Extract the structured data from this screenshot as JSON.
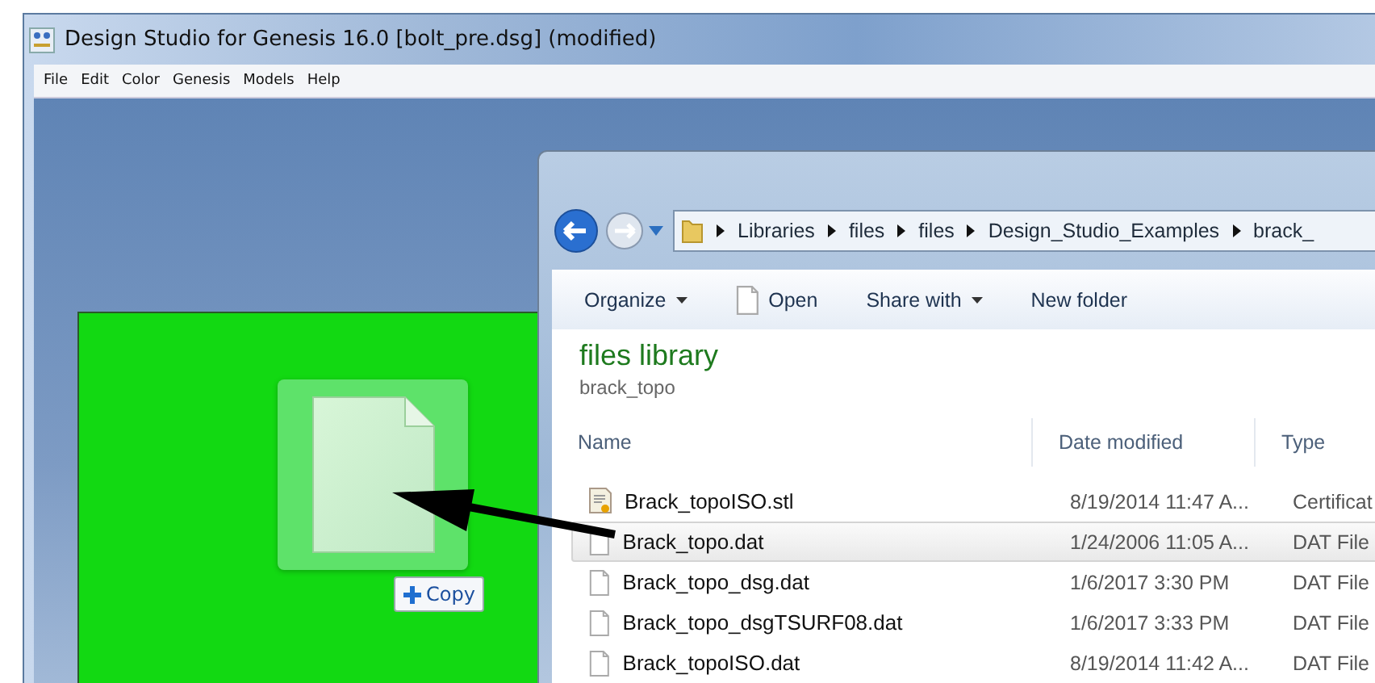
{
  "window": {
    "title": "Design Studio for Genesis 16.0 [bolt_pre.dsg] (modified)"
  },
  "menu": [
    "File",
    "Edit",
    "Color",
    "Genesis",
    "Models",
    "Help"
  ],
  "drag": {
    "badge": "Copy"
  },
  "explorer": {
    "breadcrumb": [
      "Libraries",
      "files",
      "files",
      "Design_Studio_Examples",
      "brack_"
    ],
    "toolbar": [
      {
        "label": "Organize",
        "kind": "menu"
      },
      {
        "label": "Open",
        "kind": "file"
      },
      {
        "label": "Share with",
        "kind": "menu"
      },
      {
        "label": "New folder",
        "kind": "plain"
      }
    ],
    "library_title": "files library",
    "library_subtitle": "brack_topo",
    "columns": [
      "Name",
      "Date modified",
      "Type"
    ],
    "rows": [
      {
        "name": "Brack_topoISO.stl",
        "date": "8/19/2014 11:47 A...",
        "type": "Certificat",
        "kind": "certificate",
        "selected": false
      },
      {
        "name": "Brack_topo.dat",
        "date": "1/24/2006 11:05 A...",
        "type": "DAT File",
        "kind": "file",
        "selected": true
      },
      {
        "name": "Brack_topo_dsg.dat",
        "date": "1/6/2017 3:30 PM",
        "type": "DAT File",
        "kind": "file",
        "selected": false
      },
      {
        "name": "Brack_topo_dsgTSURF08.dat",
        "date": "1/6/2017 3:33 PM",
        "type": "DAT File",
        "kind": "file",
        "selected": false
      },
      {
        "name": "Brack_topoISO.dat",
        "date": "8/19/2014 11:42 A...",
        "type": "DAT File",
        "kind": "file",
        "selected": false
      }
    ]
  }
}
